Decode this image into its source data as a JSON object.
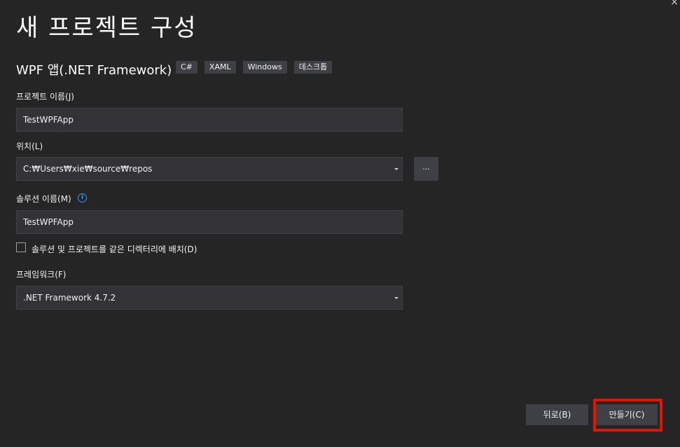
{
  "window": {
    "close_glyph": "×"
  },
  "page": {
    "title": "새 프로젝트 구성"
  },
  "template": {
    "name": "WPF 앱(.NET Framework)",
    "tags": [
      "C#",
      "XAML",
      "Windows",
      "데스크톱"
    ]
  },
  "project_name": {
    "label": "프로젝트 이름(J)",
    "value": "TestWPFApp"
  },
  "location": {
    "label": "위치(L)",
    "value": "C:₩Users₩xie₩source₩repos",
    "browse_label": "..."
  },
  "solution_name": {
    "label": "솔루션 이름(M)",
    "info_icon": "info-icon",
    "info_glyph": "i",
    "value": "TestWPFApp"
  },
  "same_dir": {
    "label": "솔루션 및 프로젝트를 같은 디렉터리에 배치(D)",
    "checked": false
  },
  "framework": {
    "label": "프레임워크(F)",
    "value": ".NET Framework 4.7.2"
  },
  "footer": {
    "back_label": "뒤로(B)",
    "create_label": "만들기(C)",
    "highlight_color": "#e51400"
  }
}
